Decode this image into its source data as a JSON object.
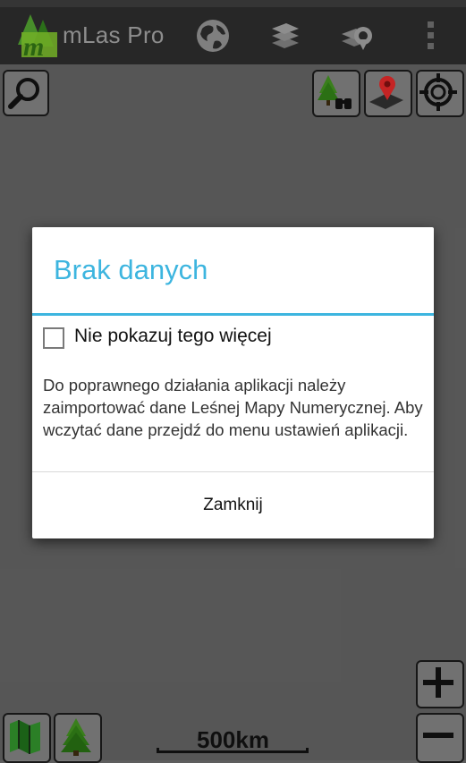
{
  "app": {
    "title": "mLas Pro"
  },
  "actionbar": {
    "icons": [
      "globe-icon",
      "layers-icon",
      "location-layers-icon",
      "overflow-menu-icon"
    ]
  },
  "map_controls": {
    "top_left": [
      "search-icon"
    ],
    "top_right": [
      "forest-binoculars-icon",
      "map-pin-icon",
      "gps-target-icon"
    ],
    "bottom_left": [
      "map-icon",
      "forest-icon"
    ],
    "bottom_right": [
      "zoom-in-icon",
      "zoom-out-icon"
    ]
  },
  "scale": {
    "label": "500km"
  },
  "dialog": {
    "title": "Brak danych",
    "checkbox_label": "Nie pokazuj tego więcej",
    "checkbox_checked": false,
    "message": "Do poprawnego działania aplikacji należy zaimportować dane Leśnej Mapy Numerycznej. Aby wczytać dane przejdź do menu ustawień aplikacji.",
    "close_button": "Zamknij"
  },
  "colors": {
    "accent": "#3db5df",
    "actionbar": "#2b2b2b",
    "map_background": "#5e5e5e"
  }
}
